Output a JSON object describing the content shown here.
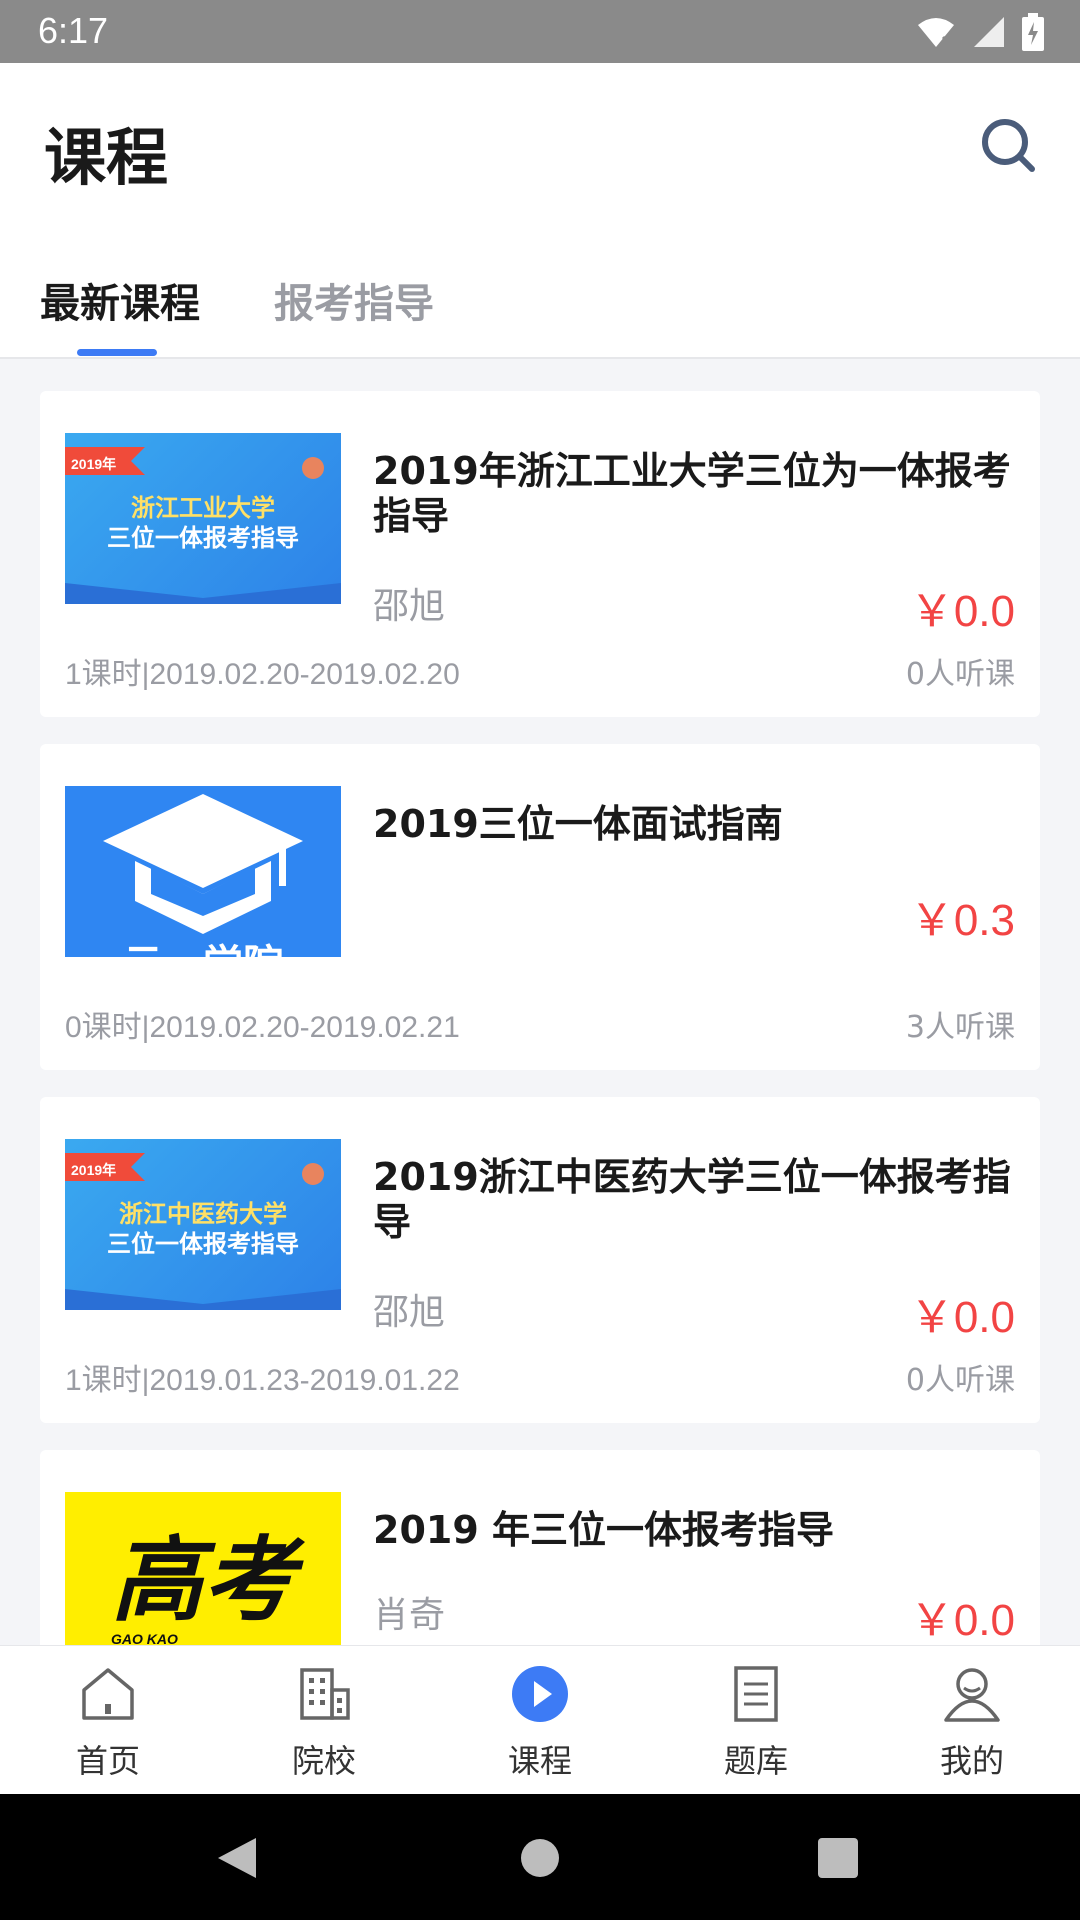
{
  "status_bar": {
    "time": "6:17"
  },
  "header": {
    "title": "课程",
    "search_icon": "search-icon"
  },
  "tabs": [
    {
      "label": "最新课程",
      "active": true
    },
    {
      "label": "报考指导",
      "active": false
    }
  ],
  "courses": [
    {
      "title": "2019年浙江工业大学三位为一体报考指导",
      "teacher": "邵旭",
      "price": "￥0.0",
      "meta": "1课时|2019.02.20-2019.02.20",
      "listeners": "0人听课",
      "thumb": {
        "badge": "2019年",
        "line1": "浙江工业大学",
        "line2": "三位一体报考指导"
      }
    },
    {
      "title": "2019三位一体面试指南",
      "teacher": "",
      "price": "￥0.3",
      "meta": "0课时|2019.02.20-2019.02.21",
      "listeners": "3人听课",
      "thumb": {
        "caption": "云一学院"
      }
    },
    {
      "title": "2019浙江中医药大学三位一体报考指导",
      "teacher": "邵旭",
      "price": "￥0.0",
      "meta": "1课时|2019.01.23-2019.01.22",
      "listeners": "0人听课",
      "thumb": {
        "badge": "2019年",
        "line1": "浙江中医药大学",
        "line2": "三位一体报考指导"
      }
    },
    {
      "title": "2019 年三位一体报考指导",
      "teacher": "肖奇",
      "price": "￥0.0",
      "meta": "",
      "listeners": "",
      "thumb": {
        "logo": "高考",
        "sub": "GAO KAO"
      }
    }
  ],
  "bottom_nav": [
    {
      "label": "首页",
      "icon": "home-icon"
    },
    {
      "label": "院校",
      "icon": "building-icon"
    },
    {
      "label": "课程",
      "icon": "play-icon",
      "active": true
    },
    {
      "label": "题库",
      "icon": "document-icon"
    },
    {
      "label": "我的",
      "icon": "user-icon"
    }
  ],
  "colors": {
    "accent": "#3d7bf5",
    "price": "#f24444"
  }
}
